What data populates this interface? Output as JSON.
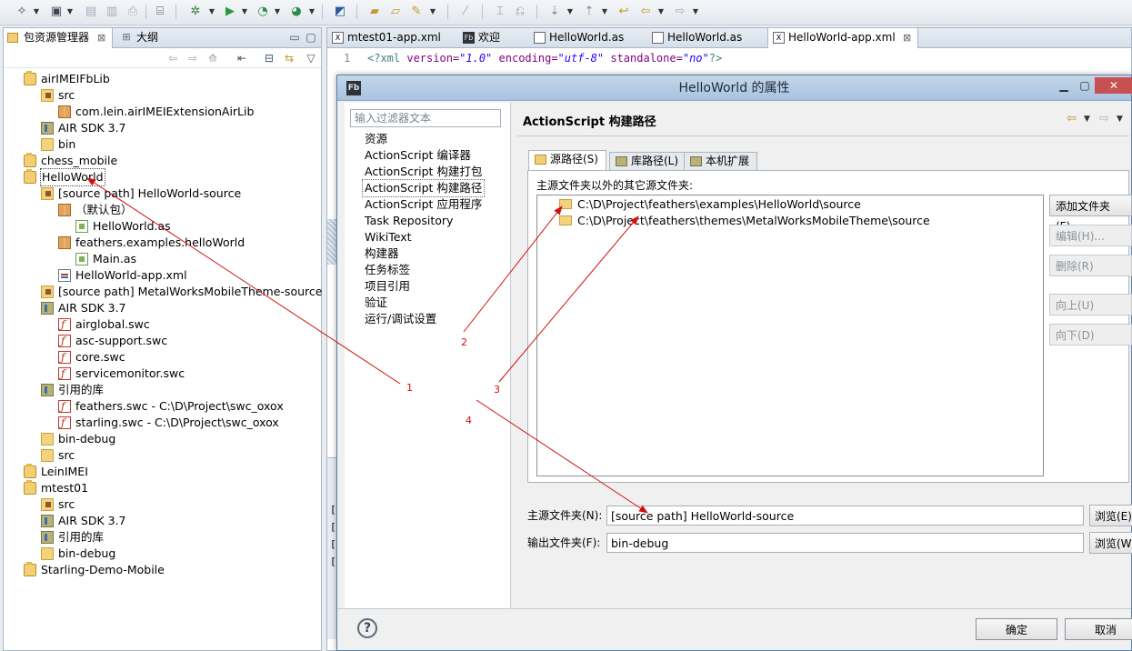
{
  "explorer": {
    "tabs": [
      {
        "label": "包资源管理器"
      },
      {
        "label": "大纲"
      }
    ],
    "tree": [
      {
        "label": "airIMEIFbLib",
        "icon": "project-icon",
        "level": 0
      },
      {
        "label": "src",
        "icon": "source-folder-icon",
        "level": 1
      },
      {
        "label": "com.lein.airIMEIExtensionAirLib",
        "icon": "package-icon",
        "level": 2
      },
      {
        "label": "AIR SDK 3.7",
        "icon": "library-icon",
        "level": 1
      },
      {
        "label": "bin",
        "icon": "folder-icon",
        "level": 1
      },
      {
        "label": "chess_mobile",
        "icon": "project-icon",
        "level": 0
      },
      {
        "label": "HelloWorld",
        "icon": "project-icon",
        "level": 0,
        "selected": true
      },
      {
        "label": "[source path] HelloWorld-source",
        "icon": "source-folder-icon",
        "level": 1
      },
      {
        "label": "（默认包）",
        "icon": "package-icon",
        "level": 2
      },
      {
        "label": "HelloWorld.as",
        "icon": "as-file-icon",
        "level": 3
      },
      {
        "label": "feathers.examples.helloWorld",
        "icon": "package-icon",
        "level": 2
      },
      {
        "label": "Main.as",
        "icon": "as-file-icon",
        "level": 3
      },
      {
        "label": "HelloWorld-app.xml",
        "icon": "xml-file-icon",
        "level": 2
      },
      {
        "label": "[source path] MetalWorksMobileTheme-source",
        "icon": "source-folder-icon",
        "level": 1
      },
      {
        "label": "AIR SDK 3.7",
        "icon": "library-icon",
        "level": 1
      },
      {
        "label": "airglobal.swc",
        "icon": "swc-file-icon",
        "level": 2
      },
      {
        "label": "asc-support.swc",
        "icon": "swc-file-icon",
        "level": 2
      },
      {
        "label": "core.swc",
        "icon": "swc-file-icon",
        "level": 2
      },
      {
        "label": "servicemonitor.swc",
        "icon": "swc-file-icon",
        "level": 2
      },
      {
        "label": "引用的库",
        "icon": "library-icon",
        "level": 1
      },
      {
        "label": "feathers.swc - C:\\D\\Project\\swc_oxox",
        "icon": "swc-file-icon",
        "level": 2
      },
      {
        "label": "starling.swc - C:\\D\\Project\\swc_oxox",
        "icon": "swc-file-icon",
        "level": 2
      },
      {
        "label": "bin-debug",
        "icon": "folder-icon",
        "level": 1
      },
      {
        "label": "src",
        "icon": "folder-icon",
        "level": 1
      },
      {
        "label": "LeinIMEI",
        "icon": "project-icon",
        "level": 0
      },
      {
        "label": "mtest01",
        "icon": "project-icon",
        "level": 0
      },
      {
        "label": "src",
        "icon": "source-folder-icon",
        "level": 1
      },
      {
        "label": "AIR SDK 3.7",
        "icon": "library-icon",
        "level": 1
      },
      {
        "label": "引用的库",
        "icon": "library-icon",
        "level": 1
      },
      {
        "label": "bin-debug",
        "icon": "folder-icon",
        "level": 1
      },
      {
        "label": "Starling-Demo-Mobile",
        "icon": "project-icon",
        "level": 0
      }
    ]
  },
  "editor": {
    "tabs": [
      {
        "label": "mtest01-app.xml",
        "icon": "xml-file-icon"
      },
      {
        "label": "欢迎",
        "icon": "flash-builder-icon"
      },
      {
        "label": "HelloWorld.as",
        "icon": "as-file-icon"
      },
      {
        "label": "HelloWorld.as",
        "icon": "as-file-icon"
      },
      {
        "label": "HelloWorld-app.xml",
        "icon": "xml-file-icon",
        "active": true
      }
    ],
    "code": {
      "line_no": "1",
      "open": "<?xml",
      "version_attr": "version=",
      "version_val": "\"1.0\"",
      "encoding_attr": "encoding=",
      "encoding_val": "\"utf-8\"",
      "standalone_attr": "standalone=",
      "standalone_val": "\"no\"",
      "close": "?>"
    },
    "console_lines": [
      "[S",
      "[S",
      "[S",
      "[自"
    ]
  },
  "dialog": {
    "title": "HelloWorld 的属性",
    "filter_placeholder": "输入过滤器文本",
    "nav_items": [
      {
        "label": "资源"
      },
      {
        "label": "ActionScript 编译器"
      },
      {
        "label": "ActionScript 构建打包"
      },
      {
        "label": "ActionScript 构建路径",
        "selected": true
      },
      {
        "label": "ActionScript 应用程序"
      },
      {
        "label": "Task Repository"
      },
      {
        "label": "WikiText"
      },
      {
        "label": "构建器"
      },
      {
        "label": "任务标签"
      },
      {
        "label": "项目引用"
      },
      {
        "label": "验证"
      },
      {
        "label": "运行/调试设置"
      }
    ],
    "page_title": "ActionScript 构建路径",
    "subtabs": [
      {
        "label": "源路径(S)",
        "active": true
      },
      {
        "label": "库路径(L)"
      },
      {
        "label": "本机扩展"
      }
    ],
    "list_label": "主源文件夹以外的其它源文件夹:",
    "source_folders": [
      "C:\\D\\Project\\feathers\\examples\\HelloWorld\\source",
      "C:\\D\\Project\\feathers\\themes\\MetalWorksMobileTheme\\source"
    ],
    "side_buttons": [
      {
        "label": "添加文件夹(F)...",
        "enabled": true
      },
      {
        "label": "编辑(H)...",
        "enabled": false
      },
      {
        "label": "删除(R)",
        "enabled": false
      },
      {
        "label": "向上(U)",
        "enabled": false
      },
      {
        "label": "向下(D)",
        "enabled": false
      }
    ],
    "main_source_label": "主源文件夹(N):",
    "main_source_value": "[source path] HelloWorld-source",
    "output_label": "输出文件夹(F):",
    "output_value": "bin-debug",
    "browse1_label": "浏览(E)...",
    "browse2_label": "浏览(W)...",
    "ok_label": "确定",
    "cancel_label": "取消",
    "help_glyph": "?"
  },
  "annotations": {
    "labels": [
      "1",
      "2",
      "3",
      "4"
    ],
    "color": "#d01010"
  },
  "colors": {
    "accent": "#a9c3df",
    "annotation": "#d01010"
  }
}
